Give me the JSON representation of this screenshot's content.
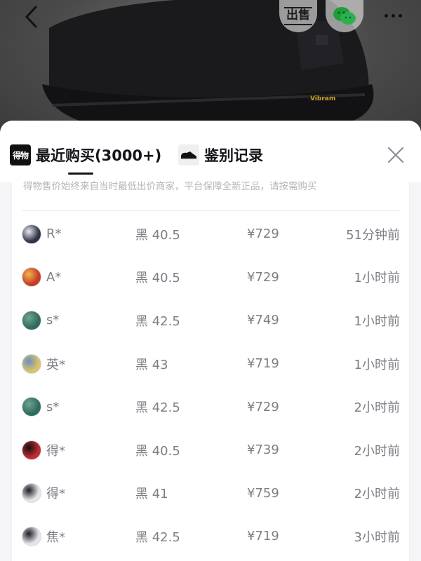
{
  "header": {
    "back_icon": "chevron-left-icon",
    "sell_label": "出售",
    "wechat_icon": "wechat-icon",
    "more_icon": "more-dots-icon"
  },
  "product": {
    "image_kind": "black-sneaker",
    "sole_badge": "Vibram",
    "sole_badge_color": "#c9a227"
  },
  "sheet": {
    "tabs": [
      {
        "label": "最近购买(3000+)",
        "icon": "dewu-logo-icon",
        "logo_text": "得物",
        "active": true
      },
      {
        "label": "鉴别记录",
        "icon": "sneaker-icon",
        "active": false
      }
    ],
    "close_icon": "close-icon",
    "notice": "得物售价始终来自当时最低出价商家，平台保障全新正品，请按需购买"
  },
  "records": [
    {
      "name": "R*",
      "size": "黑 40.5",
      "price": "¥729",
      "time": "51分钟前",
      "avatar_color": "#2f3346",
      "avatar_accent": "#e8e8ee"
    },
    {
      "name": "A*",
      "size": "黑 40.5",
      "price": "¥729",
      "time": "1小时前",
      "avatar_color": "#c83a2a",
      "avatar_accent": "#f0b54a"
    },
    {
      "name": "s*",
      "size": "黑 42.5",
      "price": "¥749",
      "time": "1小时前",
      "avatar_color": "#2f6b5e",
      "avatar_accent": "#6fa58f"
    },
    {
      "name": "英*",
      "size": "黑 43",
      "price": "¥719",
      "time": "1小时前",
      "avatar_color": "#d9c36a",
      "avatar_accent": "#6a8fc2"
    },
    {
      "name": "s*",
      "size": "黑 42.5",
      "price": "¥729",
      "time": "2小时前",
      "avatar_color": "#2f6b5e",
      "avatar_accent": "#6fa58f"
    },
    {
      "name": "得*",
      "size": "黑 40.5",
      "price": "¥739",
      "time": "2小时前",
      "avatar_color": "#c22a34",
      "avatar_accent": "#111111"
    },
    {
      "name": "得*",
      "size": "黑 41",
      "price": "¥759",
      "time": "2小时前",
      "avatar_color": "#e6e6ea",
      "avatar_accent": "#1c1c22"
    },
    {
      "name": "焦*",
      "size": "黑 42.5",
      "price": "¥719",
      "time": "3小时前",
      "avatar_color": "#e6e6ea",
      "avatar_accent": "#1c1c22"
    }
  ]
}
